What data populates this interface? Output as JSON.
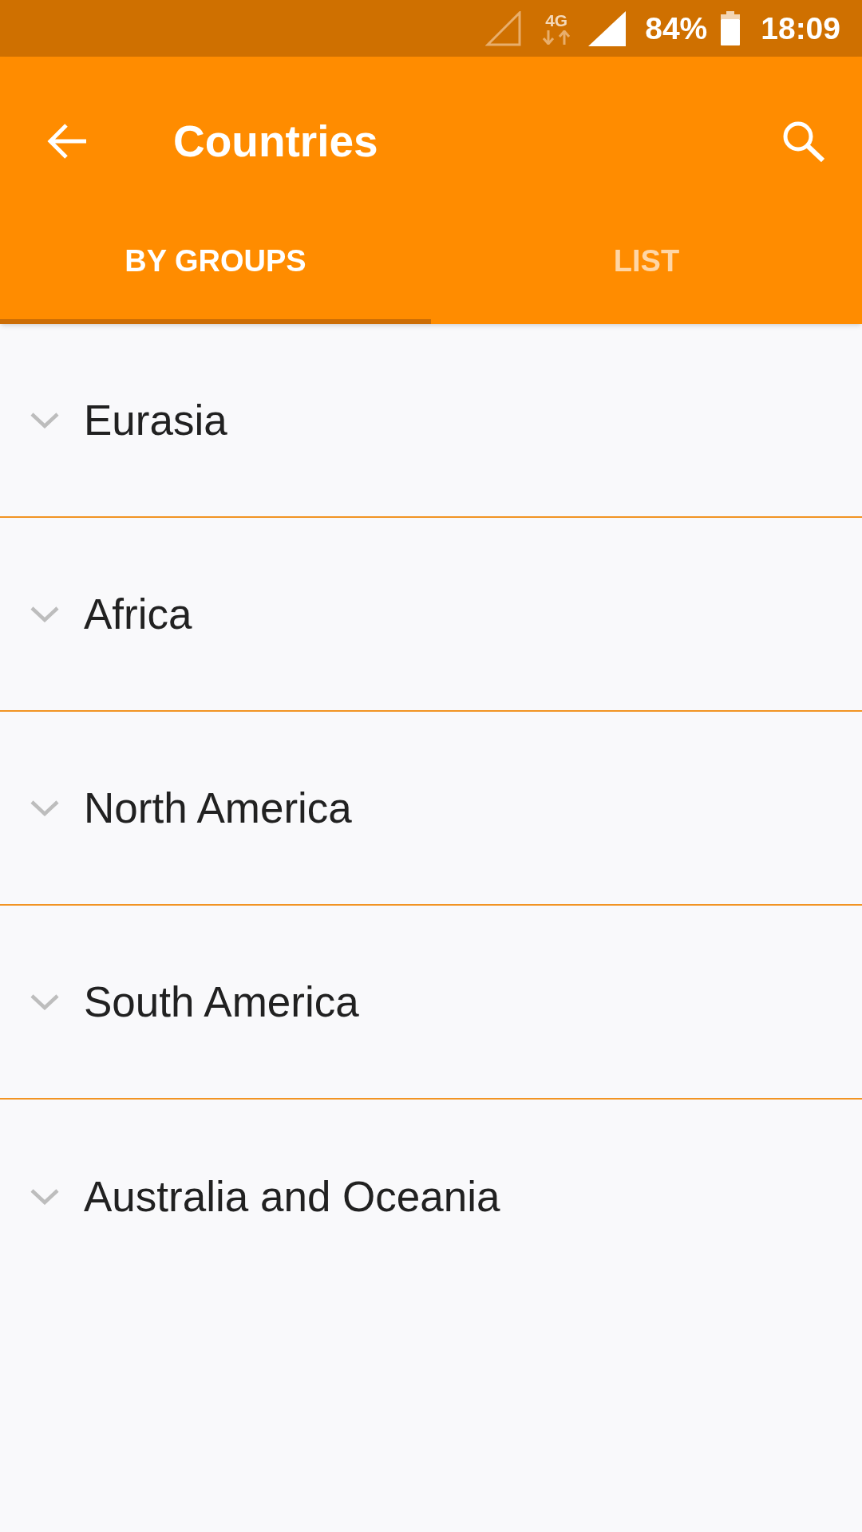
{
  "status_bar": {
    "network_type": "4G",
    "battery": "84%",
    "time": "18:09"
  },
  "app_bar": {
    "title": "Countries"
  },
  "tabs": [
    {
      "label": "BY GROUPS",
      "selected": true
    },
    {
      "label": "LIST",
      "selected": false
    }
  ],
  "groups": [
    {
      "name": "Eurasia",
      "expanded": false
    },
    {
      "name": "Africa",
      "expanded": false
    },
    {
      "name": "North America",
      "expanded": false
    },
    {
      "name": "South America",
      "expanded": false
    },
    {
      "name": "Australia and Oceania",
      "expanded": false
    }
  ]
}
